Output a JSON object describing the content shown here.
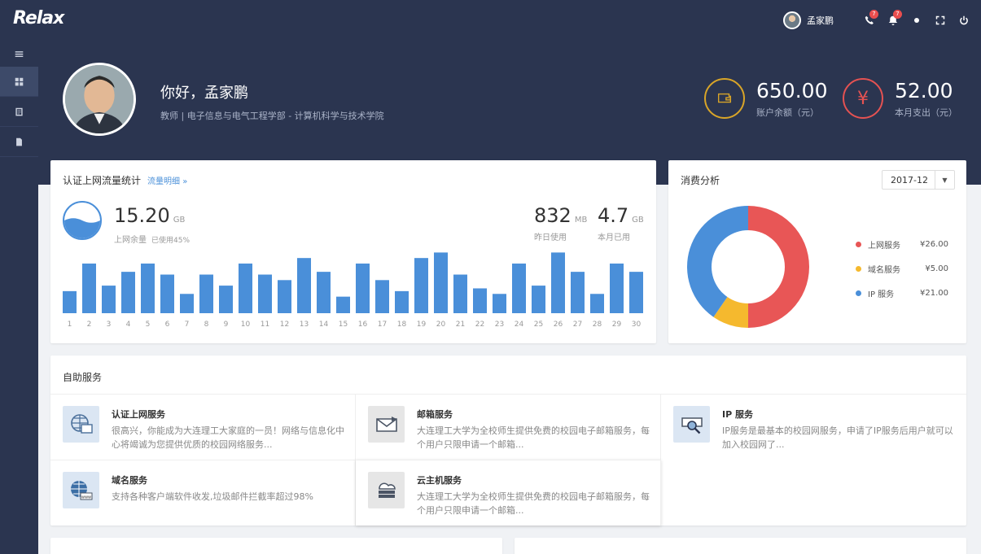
{
  "app": {
    "logo": "Relax"
  },
  "topbar": {
    "user_name": "孟家鹏",
    "phone_badge": "7",
    "bell_badge": "7"
  },
  "sidebar": {
    "items": [
      {
        "name": "menu-icon"
      },
      {
        "name": "dashboard-icon"
      },
      {
        "name": "billing-icon"
      },
      {
        "name": "document-icon"
      }
    ]
  },
  "profile": {
    "greeting": "你好，孟家鹏",
    "info": "教师  |  电子信息与电气工程学部 - 计算机科学与技术学院"
  },
  "stats": {
    "balance_value": "650.00",
    "balance_label": "账户余额（元）",
    "spend_value": "52.00",
    "spend_label": "本月支出（元）",
    "balance_color": "#d9a528",
    "spend_color": "#e55252"
  },
  "traffic": {
    "title": "认证上网流量统计",
    "link": "流量明细 »",
    "remain_value": "15.20",
    "remain_unit": "GB",
    "remain_label": "上网余量",
    "remain_used": "已使用45%",
    "yesterday_value": "832",
    "yesterday_unit": "MB",
    "yesterday_label": "昨日使用",
    "month_value": "4.7",
    "month_unit": "GB",
    "month_label": "本月已用"
  },
  "chart_data": [
    {
      "type": "bar",
      "categories": [
        "1",
        "2",
        "3",
        "4",
        "5",
        "6",
        "7",
        "8",
        "9",
        "10",
        "11",
        "12",
        "13",
        "14",
        "15",
        "16",
        "17",
        "18",
        "19",
        "20",
        "21",
        "22",
        "23",
        "24",
        "25",
        "26",
        "27",
        "28",
        "29",
        "30"
      ],
      "values": [
        4,
        9,
        5,
        7.5,
        9,
        7,
        3.5,
        7,
        5,
        9,
        7,
        6,
        10,
        7.5,
        3,
        9,
        6,
        4,
        10,
        11,
        7,
        4.5,
        3.5,
        9,
        5,
        11,
        7.5,
        3.5,
        9,
        7.5
      ],
      "ylim": [
        0,
        11.5
      ],
      "color": "#4a8fd9"
    },
    {
      "type": "pie",
      "categories": [
        "上网服务",
        "域名服务",
        "IP 服务"
      ],
      "values": [
        26,
        5,
        21
      ],
      "amount_labels": [
        "¥26.00",
        "¥5.00",
        "¥21.00"
      ],
      "colors": [
        "#e85656",
        "#f5b92e",
        "#4a8fd9"
      ]
    }
  ],
  "spend": {
    "title": "消费分析",
    "month": "2017-12"
  },
  "services": {
    "title": "自助服务",
    "items": [
      {
        "name": "认证上网服务",
        "desc": "很高兴，你能成为大连理工大家庭的一员！网络与信息化中心将竭诚为您提供优质的校园网络服务..."
      },
      {
        "name": "邮箱服务",
        "desc": "大连理工大学为全校师生提供免费的校园电子邮箱服务，每个用户只限申请一个邮箱..."
      },
      {
        "name": "IP 服务",
        "desc": "IP服务是最基本的校园网服务，申请了IP服务后用户就可以加入校园网了..."
      },
      {
        "name": "域名服务",
        "desc": "支持各种客户端软件收发,垃圾邮件拦截率超过98%"
      },
      {
        "name": "云主机服务",
        "desc": "大连理工大学为全校师生提供免费的校园电子邮箱服务，每个用户只限申请一个邮箱..."
      }
    ]
  }
}
